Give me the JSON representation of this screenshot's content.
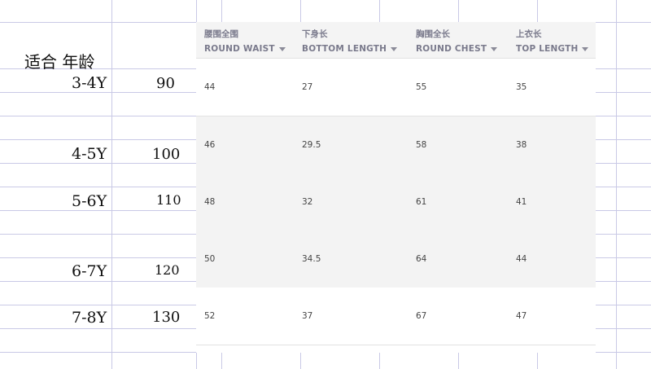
{
  "sheet": {
    "age_header": "适合 年龄",
    "rows": [
      {
        "age": "3-4Y",
        "size": "90"
      },
      {
        "age": "4-5Y",
        "size": "100"
      },
      {
        "age": "5-6Y",
        "size": "110"
      },
      {
        "age": "6-7Y",
        "size": "120"
      },
      {
        "age": "7-8Y",
        "size": "130"
      }
    ]
  },
  "table": {
    "columns": [
      {
        "zh": "腰围全围",
        "en": "ROUND WAIST"
      },
      {
        "zh": "下身长",
        "en": "BOTTOM LENGTH"
      },
      {
        "zh": "胸围全长",
        "en": "ROUND CHEST"
      },
      {
        "zh": "上衣长",
        "en": "TOP LENGTH"
      }
    ],
    "rows": [
      [
        "44",
        "27",
        "55",
        "35"
      ],
      [
        "46",
        "29.5",
        "58",
        "38"
      ],
      [
        "48",
        "32",
        "61",
        "41"
      ],
      [
        "50",
        "34.5",
        "64",
        "44"
      ],
      [
        "52",
        "37",
        "67",
        "47"
      ]
    ]
  },
  "colors": {
    "gridline": "#c9c9e6",
    "header_bg": "#f4f4f4",
    "header_text": "#7a7a8c",
    "stripe": "#f3f3f3"
  }
}
